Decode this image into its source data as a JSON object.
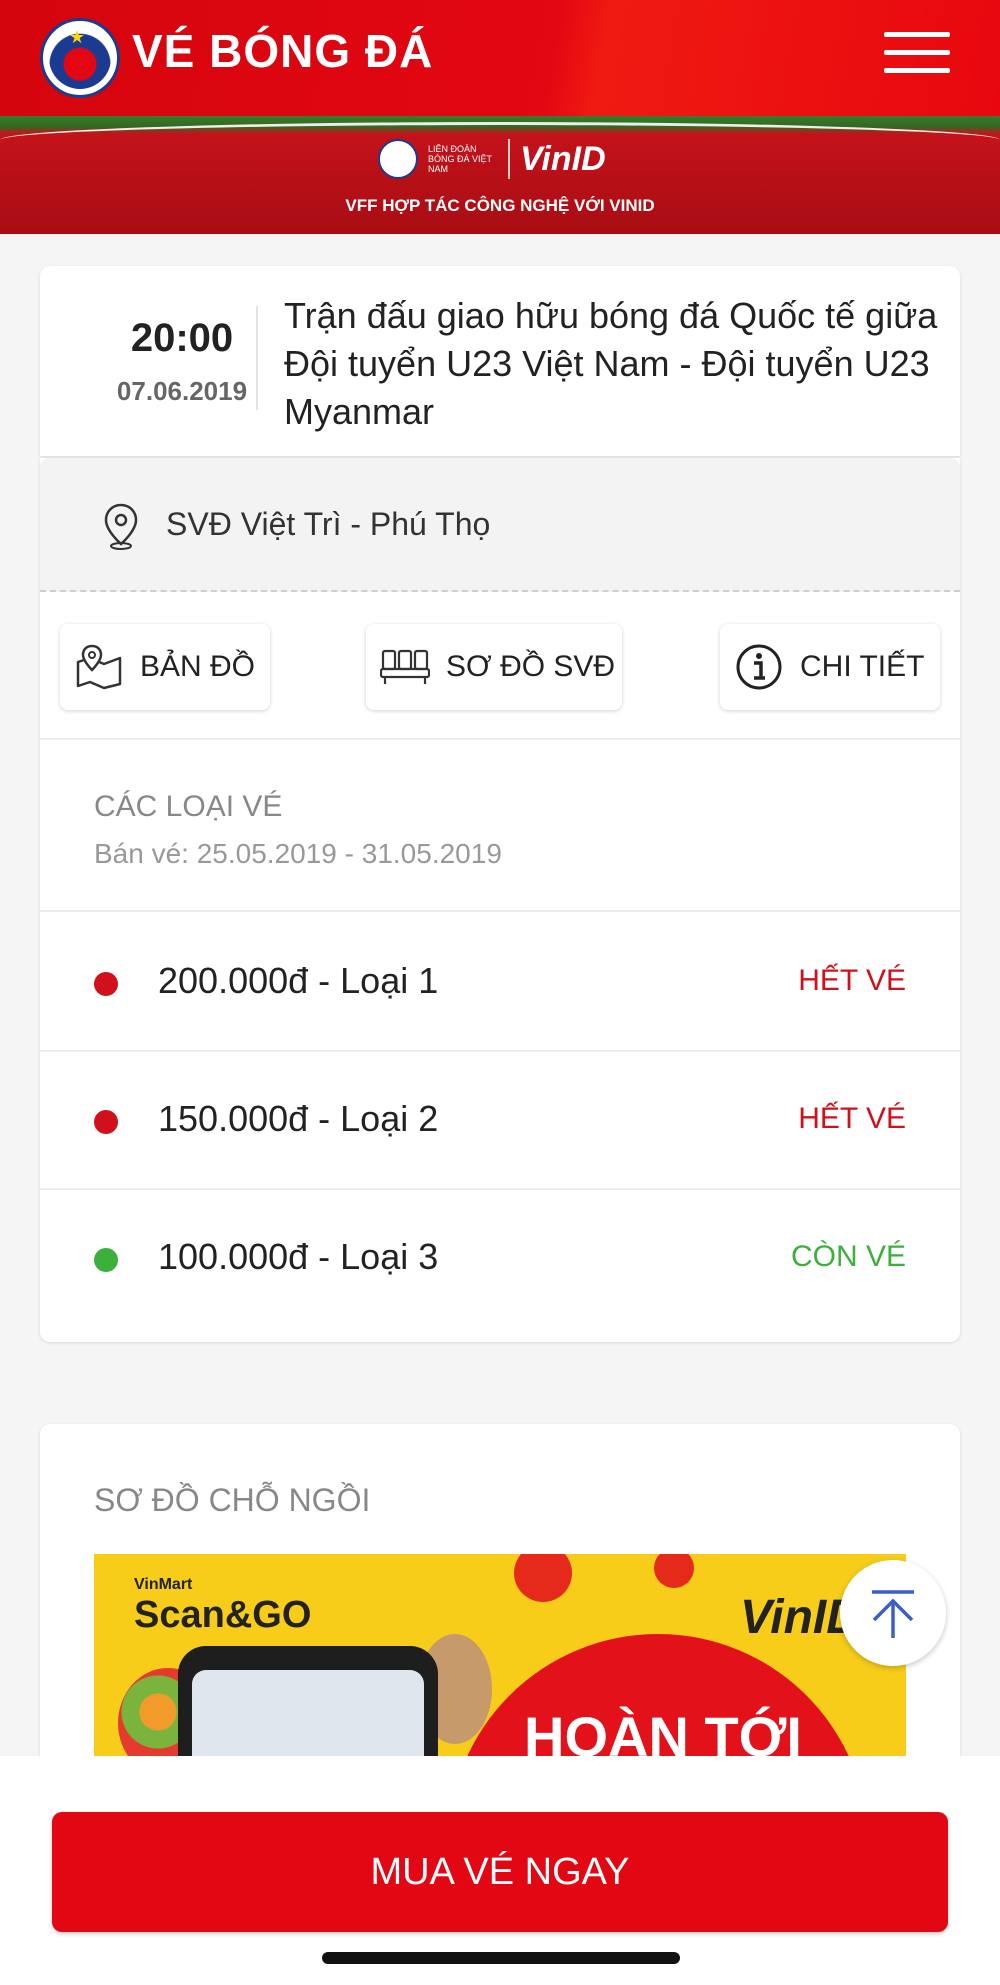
{
  "header": {
    "brand": "VÉ BÓNG ĐÁ",
    "logo_text": "VFF",
    "menu_icon": "hamburger-menu-icon",
    "brand_color": "#e30613"
  },
  "banner": {
    "vff_text": "LIÊN ĐOÀN BÓNG ĐÁ VIỆT NAM",
    "vinid_text": "VinID",
    "caption": "VFF HỢP TÁC CÔNG NGHỆ VỚI VINID"
  },
  "match": {
    "time": "20:00",
    "date": "07.06.2019",
    "title": "Trận đấu giao hữu bóng đá Quốc tế giữa Đội tuyển U23 Việt Nam - Đội tuyển U23 Myanmar"
  },
  "venue": {
    "icon": "location-pin-icon",
    "name": "SVĐ Việt Trì - Phú Thọ"
  },
  "actions": {
    "map_label": "BẢN ĐỒ",
    "seatmap_label": "SƠ ĐỒ SVĐ",
    "detail_label": "CHI TIẾT"
  },
  "tickets": {
    "title": "CÁC LOẠI VÉ",
    "sale_period": "Bán vé: 25.05.2019 - 31.05.2019",
    "items": [
      {
        "name": "200.000đ - Loại 1",
        "status": "HẾT VÉ",
        "color": "#d0101a"
      },
      {
        "name": "150.000đ - Loại 2",
        "status": "HẾT VÉ",
        "color": "#d0101a"
      },
      {
        "name": "100.000đ - Loại 3",
        "status": "CÒN VÉ",
        "color": "#3bb03b"
      }
    ]
  },
  "seat_map": {
    "title": "SƠ ĐỒ CHỖ NGỒI",
    "ad_brand_small": "VinMart",
    "ad_brand": "Scan&GO",
    "ad_brand_right": "VinID",
    "ad_text": "HOÀN TỚI"
  },
  "buy_button": {
    "label": "MUA VÉ NGAY"
  }
}
